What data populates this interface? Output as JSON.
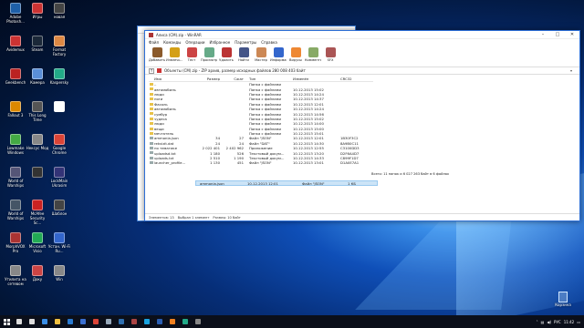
{
  "desktop": {
    "icons": [
      {
        "label": "Adobe Photosh...",
        "color": "#1e5fa8"
      },
      {
        "label": "Игры",
        "color": "#c33"
      },
      {
        "label": "новая",
        "color": "#444"
      },
      {
        "label": "Avidemux",
        "color": "#c33"
      },
      {
        "label": "Steam",
        "color": "#1b2838"
      },
      {
        "label": "Format Factory",
        "color": "#d84"
      },
      {
        "label": "Geekbench",
        "color": "#b22"
      },
      {
        "label": "Камера",
        "color": "#5a8fd8"
      },
      {
        "label": "Kaspersky",
        "color": "#2a8"
      },
      {
        "label": "Fallout 3",
        "color": "#d80"
      },
      {
        "label": "This Long Time",
        "color": "#555"
      },
      {
        "label": "",
        "color": "#fff"
      },
      {
        "label": "Lowmake Windows",
        "color": "#4a4"
      },
      {
        "label": "Нексус Мод",
        "color": "#888"
      },
      {
        "label": "Google Chrome",
        "color": "#db4437"
      },
      {
        "label": "World of Warships",
        "color": "#557"
      },
      {
        "label": "",
        "color": "#333"
      },
      {
        "label": "LockMain Ukrasim",
        "color": "#337"
      },
      {
        "label": "World of Warships",
        "color": "#456"
      },
      {
        "label": "McAfee Security Sc...",
        "color": "#c22"
      },
      {
        "label": "Шаблон",
        "color": "#444"
      },
      {
        "label": "MorphVOX Pro",
        "color": "#a33"
      },
      {
        "label": "Microsoft Visio",
        "color": "#2a5"
      },
      {
        "label": "Устан. Wi-Fi Ru...",
        "color": "#36c"
      },
      {
        "label": "Утилита на сетевом",
        "color": "#888"
      },
      {
        "label": "Доку",
        "color": "#c44"
      },
      {
        "label": "Win",
        "color": "#888"
      }
    ],
    "recycle_label": "Корзина"
  },
  "winrar": {
    "title": "Алиса (СМ).zip - WinRAR",
    "menu": [
      "Файл",
      "Команды",
      "Операции",
      "Избранное",
      "Параметры",
      "Справка"
    ],
    "toolbar": [
      {
        "label": "Добавить",
        "color": "#8b5a2b"
      },
      {
        "label": "Извлечь...",
        "color": "#d4a017"
      },
      {
        "label": "Тест",
        "color": "#c44"
      },
      {
        "label": "Просмотр",
        "color": "#6a8"
      },
      {
        "label": "Удалить",
        "color": "#b33"
      },
      {
        "label": "Найти",
        "color": "#458"
      },
      {
        "label": "Мастер",
        "color": "#c85"
      },
      {
        "label": "Информация",
        "color": "#36c"
      },
      {
        "label": "Вирусы",
        "color": "#e83"
      },
      {
        "label": "Комментарий",
        "color": "#8a6"
      },
      {
        "label": "SFX",
        "color": "#a55"
      }
    ],
    "path": "Объекты (СМ).zip - ZIP архив, размер исходных файлов 280 008 403 байт",
    "columns": [
      "Имя",
      "Размер",
      "Сжат",
      "Тип",
      "Изменён",
      "CRC32"
    ],
    "rows": [
      {
        "name": "..",
        "size": "",
        "packed": "",
        "type": "Папка с файлами",
        "modified": "",
        "crc": ""
      },
      {
        "name": "автомобиль",
        "size": "",
        "packed": "",
        "type": "Папка с файлами",
        "modified": "10.12.2013 15:02",
        "crc": ""
      },
      {
        "name": "люди",
        "size": "",
        "packed": "",
        "type": "Папка с файлами",
        "modified": "10.12.2013 14:24",
        "crc": ""
      },
      {
        "name": "ноги",
        "size": "",
        "packed": "",
        "type": "Папка с файлами",
        "modified": "10.12.2013 14:37",
        "crc": ""
      },
      {
        "name": "Фасоль",
        "size": "",
        "packed": "",
        "type": "Папка с файлами",
        "modified": "10.12.2013 12:01",
        "crc": ""
      },
      {
        "name": "автомобиль",
        "size": "",
        "packed": "",
        "type": "Папка с файлами",
        "modified": "10.12.2013 14:24",
        "crc": ""
      },
      {
        "name": "сумбур",
        "size": "",
        "packed": "",
        "type": "Папка с файлами",
        "modified": "10.12.2013 14:56",
        "crc": ""
      },
      {
        "name": "чудеса",
        "size": "",
        "packed": "",
        "type": "Папка с файлами",
        "modified": "10.12.2013 15:02",
        "crc": ""
      },
      {
        "name": "люди",
        "size": "",
        "packed": "",
        "type": "Папка с файлами",
        "modified": "10.12.2013 14:00",
        "crc": ""
      },
      {
        "name": "вещи",
        "size": "",
        "packed": "",
        "type": "Папка с файлами",
        "modified": "10.12.2013 15:00",
        "crc": ""
      },
      {
        "name": "мечтатель",
        "size": "",
        "packed": "",
        "type": "Папка с файлами",
        "modified": "10.12.2013 15:01",
        "crc": ""
      },
      {
        "name": "ammonia.json",
        "size": "34",
        "packed": "27",
        "type": "Файл \"JSON\"",
        "modified": "10.12.2013 12:01",
        "crc": "1B30F3C2"
      },
      {
        "name": "rekvizit.dat",
        "size": "24",
        "packed": "24",
        "type": "Файл \"DAT\"",
        "modified": "10.12.2013 14:30",
        "crc": "8A9B0C11"
      },
      {
        "name": "по тематике",
        "size": "2 022 401",
        "packed": "2 402 962",
        "type": "Приложение",
        "modified": "10.12.2013 12:55",
        "crc": "C3100DD3"
      },
      {
        "name": "uploadsd.txt",
        "size": "1 180",
        "packed": "526",
        "type": "Текстовый докум...",
        "modified": "10.12.2013 13:20",
        "crc": "D2F6A4D7"
      },
      {
        "name": "uploads.txt",
        "size": "2 510",
        "packed": "1 190",
        "type": "Текстовый докум...",
        "modified": "10.12.2013 14:33",
        "crc": "C899F1D7"
      },
      {
        "name": "launcher_profile...",
        "size": "1 130",
        "packed": "451",
        "type": "Файл \"JSON\"",
        "modified": "10.12.2013 13:01",
        "crc": "D1A0E7A1"
      }
    ],
    "drag_row": {
      "name": "ammonia.json",
      "modified": "10.12.2013 12:01",
      "type": "Файл \"JSON\"",
      "size": "1 КБ"
    },
    "status_right": "Всего: 11 папок и 6 027 263 байт в 6 файлах",
    "status_left": [
      "Элементов: 13",
      "Выбран 1 элемент",
      "Размер: 10 байт"
    ]
  },
  "taskbar": {
    "icons": [
      {
        "name": "search",
        "color": "#ddd"
      },
      {
        "name": "task-view",
        "color": "#ddd"
      },
      {
        "name": "edge",
        "color": "#3a8ee6"
      },
      {
        "name": "explorer",
        "color": "#f0c040"
      },
      {
        "name": "store",
        "color": "#2a7ad0"
      },
      {
        "name": "mail",
        "color": "#3a6fd0"
      },
      {
        "name": "chrome",
        "color": "#db4437"
      },
      {
        "name": "steam",
        "color": "#9ab"
      },
      {
        "name": "photoshop",
        "color": "#2f6fb0"
      },
      {
        "name": "winrar",
        "color": "#a44"
      },
      {
        "name": "skype",
        "color": "#19a3e0"
      },
      {
        "name": "word",
        "color": "#2b5fb3"
      },
      {
        "name": "vlc",
        "color": "#f08020"
      },
      {
        "name": "kaspersky",
        "color": "#2a8"
      },
      {
        "name": "app",
        "color": "#888"
      }
    ],
    "tray_lang": "РУС",
    "clock": "11:42"
  }
}
